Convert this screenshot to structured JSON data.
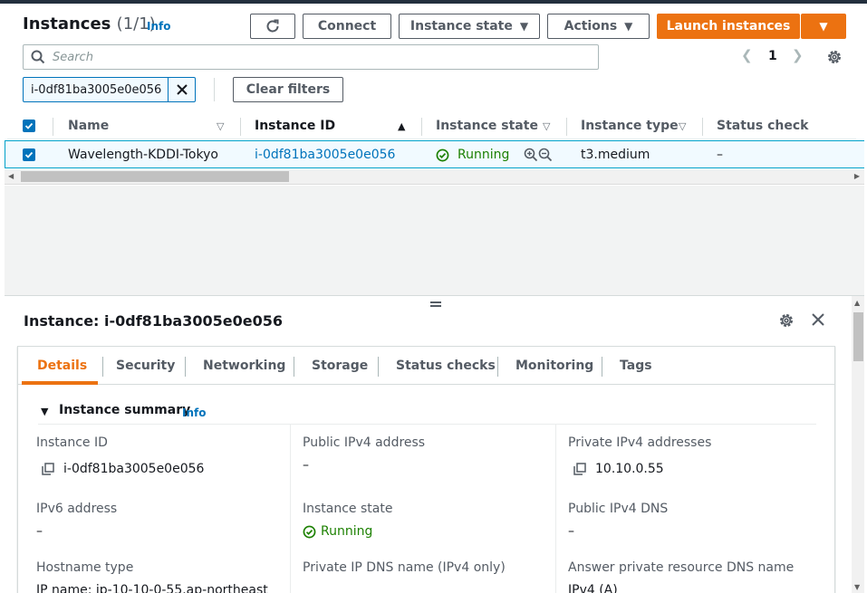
{
  "header": {
    "title": "Instances",
    "count": "(1/1)",
    "info": "Info"
  },
  "toolbar": {
    "connect": "Connect",
    "instance_state": "Instance state",
    "actions": "Actions",
    "launch": "Launch instances"
  },
  "search": {
    "placeholder": "Search"
  },
  "pagination": {
    "page": "1"
  },
  "filter": {
    "token": "i-0df81ba3005e0e056",
    "clear": "Clear filters"
  },
  "table": {
    "columns": [
      "Name",
      "Instance ID",
      "Instance state",
      "Instance type",
      "Status check"
    ],
    "row": {
      "name": "Wavelength-KDDI-Tokyo",
      "instance_id": "i-0df81ba3005e0e056",
      "state": "Running",
      "type": "t3.medium",
      "status_check": "–"
    }
  },
  "panel": {
    "title": "Instance: i-0df81ba3005e0e056",
    "tabs": [
      "Details",
      "Security",
      "Networking",
      "Storage",
      "Status checks",
      "Monitoring",
      "Tags"
    ],
    "summary_title": "Instance summary",
    "summary_info": "Info",
    "fields": {
      "instance_id_label": "Instance ID",
      "instance_id_value": "i-0df81ba3005e0e056",
      "public_ipv4_label": "Public IPv4 address",
      "public_ipv4_value": "–",
      "private_ipv4_label": "Private IPv4 addresses",
      "private_ipv4_value": "10.10.0.55",
      "ipv6_label": "IPv6 address",
      "ipv6_value": "–",
      "state_label": "Instance state",
      "state_value": "Running",
      "public_dns_label": "Public IPv4 DNS",
      "public_dns_value": "–",
      "hostname_type_label": "Hostname type",
      "hostname_type_value": "IP name: ip-10-10-0-55.ap-northeast",
      "private_dns_label": "Private IP DNS name (IPv4 only)",
      "answer_dns_label": "Answer private resource DNS name",
      "answer_dns_value": "IPv4 (A)"
    }
  },
  "colors": {
    "accent": "#ec7211",
    "link": "#0073bb",
    "success": "#1d8102"
  },
  "icons": [
    "refresh-icon",
    "search-icon",
    "gear-icon",
    "close-icon",
    "check-circle-icon",
    "zoom-in-icon",
    "zoom-out-icon",
    "copy-icon",
    "caret-down-icon",
    "chevron-left-icon",
    "chevron-right-icon"
  ]
}
